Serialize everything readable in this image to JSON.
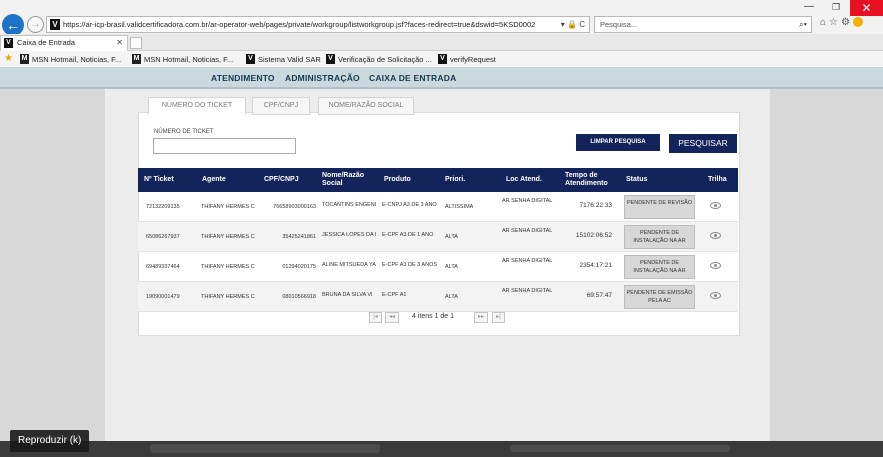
{
  "browser": {
    "url": "https://ar-icp-brasil.validcertificadora.com.br/ar-operator-web/pages/private/workgroup/listworkgroup.jsf?faces-redirect=true&dswid=5KSD0002",
    "addr_icons": "▾ 🔒 C",
    "search_placeholder": "Pesquisa...",
    "search_icon": "⌕▾",
    "tab_title": "Caixa de Entrada",
    "favicon_letter": "V",
    "favorites": [
      "MSN Hotmail, Noticias, F...",
      "MSN Hotmail, Noticias, F...",
      "Sistema Valid SAR",
      "Verificação de Solicitação ...",
      "verifyRequest"
    ]
  },
  "app_nav": {
    "items": [
      "ATENDIMENTO",
      "ADMINISTRAÇÃO",
      "CAIXA DE ENTRADA"
    ]
  },
  "filter_tabs": [
    "NÚMERO DO TICKET",
    "CPF/CNPJ",
    "NOME/RAZÃO SOCIAL"
  ],
  "search_form": {
    "ticket_label": "NÚMERO DE TICKET",
    "ticket_value": "",
    "clear_label": "LIMPAR PESQUISA",
    "search_label": "PESQUISAR"
  },
  "table": {
    "headers": {
      "ticket": "Nº Ticket",
      "agent": "Agente",
      "cpf": "CPF/CNPJ",
      "nome": "Nome/Razão Social",
      "produto": "Produto",
      "prior": "Priori.",
      "loc": "Loc Atend.",
      "tempo": "Tempo de Atendimento",
      "status": "Status",
      "trilha": "Trilha"
    },
    "rows": [
      {
        "ticket": "72132209135",
        "agent": "THIFANY HERMES C",
        "cpf": "76658903000163",
        "nome": "TOCANTINS ENGENI",
        "produto": "E-CNPJ A3 DE 3 ANO",
        "prior": "ALTÍSSIMA",
        "loc": "AR SENHA DIGITAL",
        "tempo": "7176:22:33",
        "status": "PENDENTE DE REVISÃO"
      },
      {
        "ticket": "65086267937",
        "agent": "THIFANY HERMES C",
        "cpf": "35425241861",
        "nome": "JESSICA LOPES DA I",
        "produto": "E-CPF A3 DE 1 ANO",
        "prior": "ALTA",
        "loc": "AR SENHA DIGITAL",
        "tempo": "15102:06:52",
        "status": "PENDENTE DE INSTALAÇÃO NA AR"
      },
      {
        "ticket": "69489337464",
        "agent": "THIFANY HERMES C",
        "cpf": "01294020175",
        "nome": "ALINE MITSUEDA YA",
        "produto": "E-CPF A3 DE 3 ANOS",
        "prior": "ALTA",
        "loc": "AR SENHA DIGITAL",
        "tempo": "2354:17:21",
        "status": "PENDENTE DE INSTALAÇÃO NA AR"
      },
      {
        "ticket": "19090001479",
        "agent": "THIFANY HERMES C",
        "cpf": "08010566918",
        "nome": "BRUNA DA SILVA VI",
        "produto": "E-CPF A1",
        "prior": "ALTA",
        "loc": "AR SENHA DIGITAL",
        "tempo": "69:57:47",
        "status": "PENDENTE DE EMISSÃO PELA AC"
      }
    ]
  },
  "pagination": {
    "first": "|◂",
    "prev": "◂◂",
    "text": "4 itens 1 de 1",
    "next": "▸▸",
    "last": "▸|"
  },
  "overlay": {
    "label": "Reproduzir (k)"
  },
  "colors": {
    "primary": "#13245a",
    "nav_bg": "#c9d9de",
    "close": "#e81123"
  }
}
